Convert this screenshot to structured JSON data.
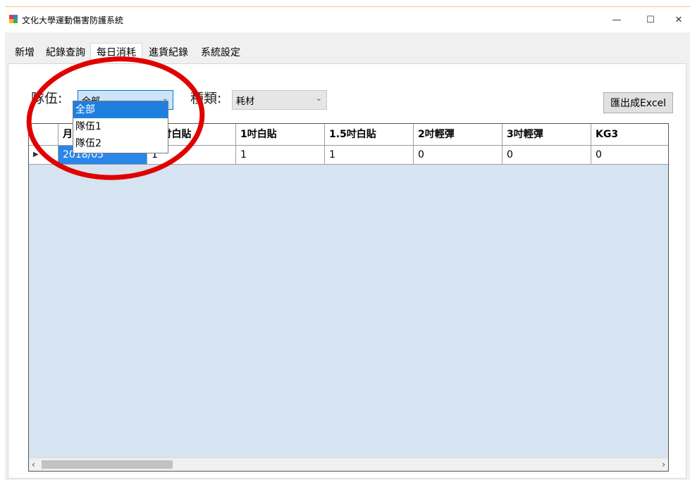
{
  "window": {
    "title": "文化大學運動傷害防護系統"
  },
  "controls": {
    "minimize": "—",
    "maximize": "☐",
    "close": "✕"
  },
  "tabs": [
    "新增",
    "紀錄查詢",
    "每日消耗",
    "進貨紀錄",
    "系統設定"
  ],
  "active_tab": "每日消耗",
  "filters": {
    "team_label": "隊伍:",
    "team_value": "全部",
    "team_options": [
      "全部",
      "隊伍1",
      "隊伍2"
    ],
    "type_label": "種類:",
    "type_value": "耗材"
  },
  "export_button": "匯出成Excel",
  "grid": {
    "columns": [
      "月份",
      "½吋白貼",
      "1吋白貼",
      "1.5吋白貼",
      "2吋輕彈",
      "3吋輕彈",
      "KG3"
    ],
    "row": [
      "2018/05",
      "1",
      "1",
      "1",
      "0",
      "0",
      "0"
    ],
    "row_marker": "▶"
  },
  "scroll": {
    "left_arrow": "‹",
    "right_arrow": "›"
  },
  "colors": {
    "annotation": "#e00000",
    "selection": "#1f7fdf",
    "grid_bg": "#d6e3f0"
  }
}
